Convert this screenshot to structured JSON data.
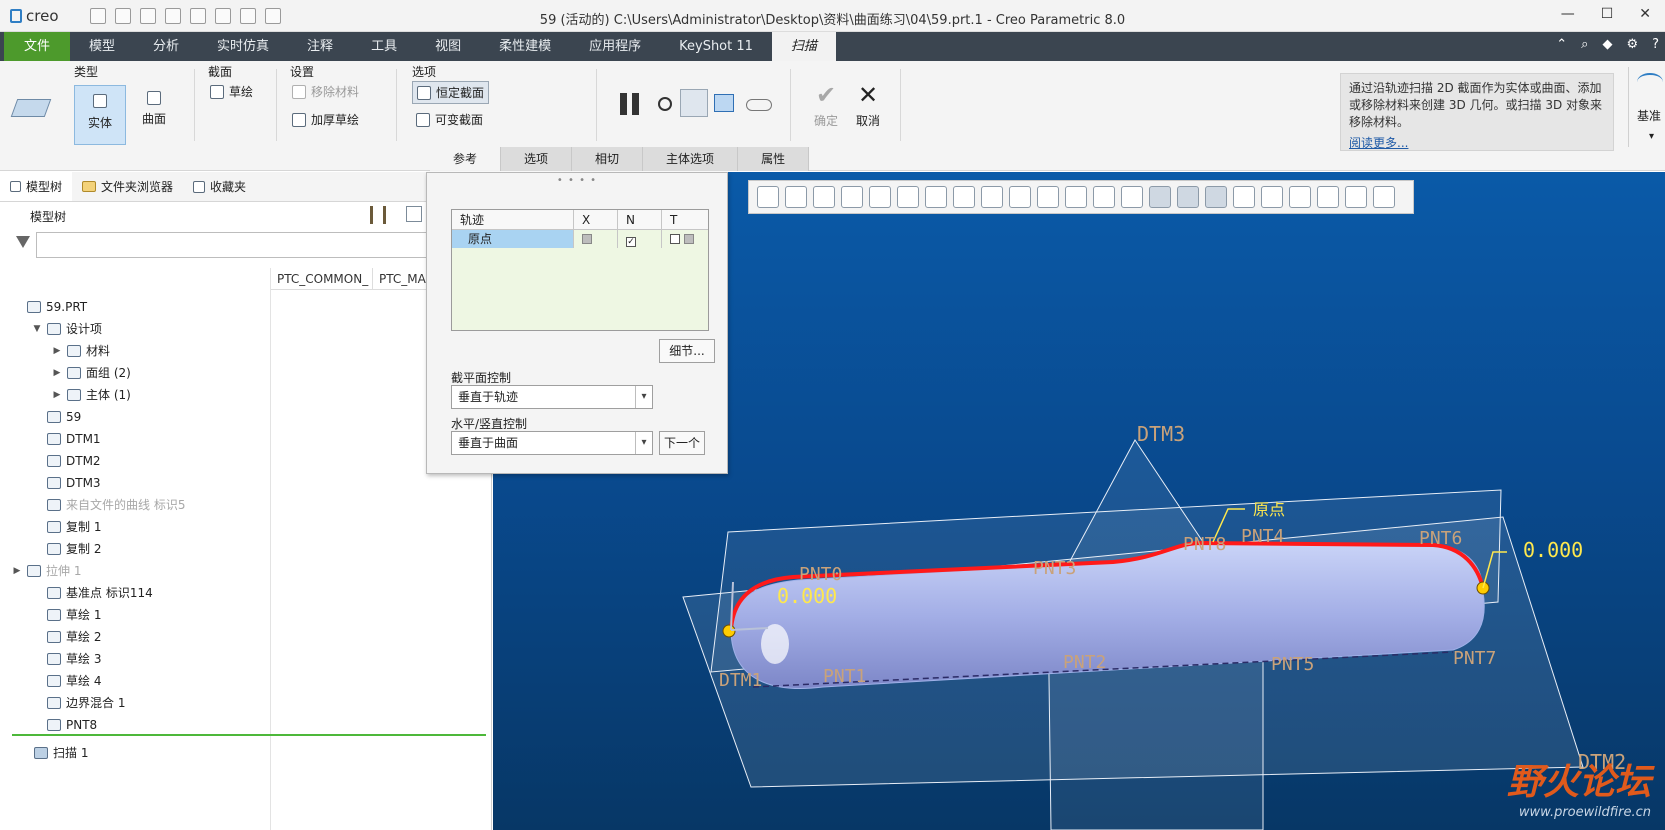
{
  "titlebar": {
    "logo": "creo",
    "title": "59 (活动的) C:\\Users\\Administrator\\Desktop\\资料\\曲面练习\\04\\59.prt.1 - Creo Parametric 8.0"
  },
  "menu": {
    "file": "文件",
    "tabs": [
      "模型",
      "分析",
      "实时仿真",
      "注释",
      "工具",
      "视图",
      "柔性建模",
      "应用程序",
      "KeyShot 11",
      "扫描"
    ]
  },
  "ribbon": {
    "type_title": "类型",
    "solid": "实体",
    "surface": "曲面",
    "section_title": "截面",
    "sketch": "草绘",
    "settings_title": "设置",
    "remove_material": "移除材料",
    "thicken_sketch": "加厚草绘",
    "options_title": "选项",
    "constant_section": "恒定截面",
    "variable_section": "可变截面",
    "ok": "确定",
    "cancel": "取消",
    "help_text": "通过沿轨迹扫描 2D 截面作为实体或曲面、添加或移除材料来创建 3D 几何。或扫描 3D 对象来移除材料。",
    "help_link": "阅读更多...",
    "datum": "基准",
    "tabs": [
      "参考",
      "选项",
      "相切",
      "主体选项",
      "属性"
    ]
  },
  "leftpanel": {
    "tabs": [
      "模型树",
      "文件夹浏览器",
      "收藏夹"
    ],
    "header": "模型树",
    "columns": [
      "PTC_COMMON_",
      "PTC_MA"
    ],
    "tree": [
      {
        "label": "59.PRT",
        "indent": 0,
        "exp": "",
        "dim": false
      },
      {
        "label": "设计项",
        "indent": 1,
        "exp": "▼",
        "dim": false
      },
      {
        "label": "材料",
        "indent": 2,
        "exp": "▶",
        "dim": false
      },
      {
        "label": "面组 (2)",
        "indent": 2,
        "exp": "▶",
        "dim": false
      },
      {
        "label": "主体 (1)",
        "indent": 2,
        "exp": "▶",
        "dim": false
      },
      {
        "label": "59",
        "indent": 1,
        "exp": "",
        "dim": false
      },
      {
        "label": "DTM1",
        "indent": 1,
        "exp": "",
        "dim": false
      },
      {
        "label": "DTM2",
        "indent": 1,
        "exp": "",
        "dim": false
      },
      {
        "label": "DTM3",
        "indent": 1,
        "exp": "",
        "dim": false
      },
      {
        "label": "来自文件的曲线 标识5",
        "indent": 1,
        "exp": "",
        "dim": true
      },
      {
        "label": "复制 1",
        "indent": 1,
        "exp": "",
        "dim": false
      },
      {
        "label": "复制 2",
        "indent": 1,
        "exp": "",
        "dim": false
      },
      {
        "label": "拉伸 1",
        "indent": 0,
        "exp": "▶",
        "dim": true
      },
      {
        "label": "基准点 标识114",
        "indent": 1,
        "exp": "",
        "dim": false
      },
      {
        "label": "草绘 1",
        "indent": 1,
        "exp": "",
        "dim": false
      },
      {
        "label": "草绘 2",
        "indent": 1,
        "exp": "",
        "dim": false
      },
      {
        "label": "草绘 3",
        "indent": 1,
        "exp": "",
        "dim": false
      },
      {
        "label": "草绘 4",
        "indent": 1,
        "exp": "",
        "dim": false
      },
      {
        "label": "边界混合 1",
        "indent": 1,
        "exp": "",
        "dim": false
      },
      {
        "label": "PNT8",
        "indent": 1,
        "exp": "",
        "dim": false
      }
    ],
    "current": "扫描 1"
  },
  "popup": {
    "col_traj": "轨迹",
    "col_x": "X",
    "col_n": "N",
    "col_t": "T",
    "row_origin": "原点",
    "details": "细节...",
    "section_plane_label": "截平面控制",
    "section_plane_value": "垂直于轨迹",
    "hv_label": "水平/竖直控制",
    "hv_value": "垂直于曲面",
    "next": "下一个"
  },
  "viewport": {
    "labels": {
      "dtm3": "DTM3",
      "dtm1": "DTM1",
      "dtm2": "DTM2",
      "origin": "原点",
      "pnt0": "PNT0",
      "pnt1": "PNT1",
      "pnt2": "PNT2",
      "pnt3": "PNT3",
      "pnt4": "PNT4",
      "pnt5": "PNT5",
      "pnt6": "PNT6",
      "pnt7": "PNT7",
      "pnt8": "PNT8",
      "dim_left": "0.000",
      "dim_right": "0.000"
    },
    "watermark_main": "野火论坛",
    "watermark_url": "www.proewildfire.cn"
  }
}
